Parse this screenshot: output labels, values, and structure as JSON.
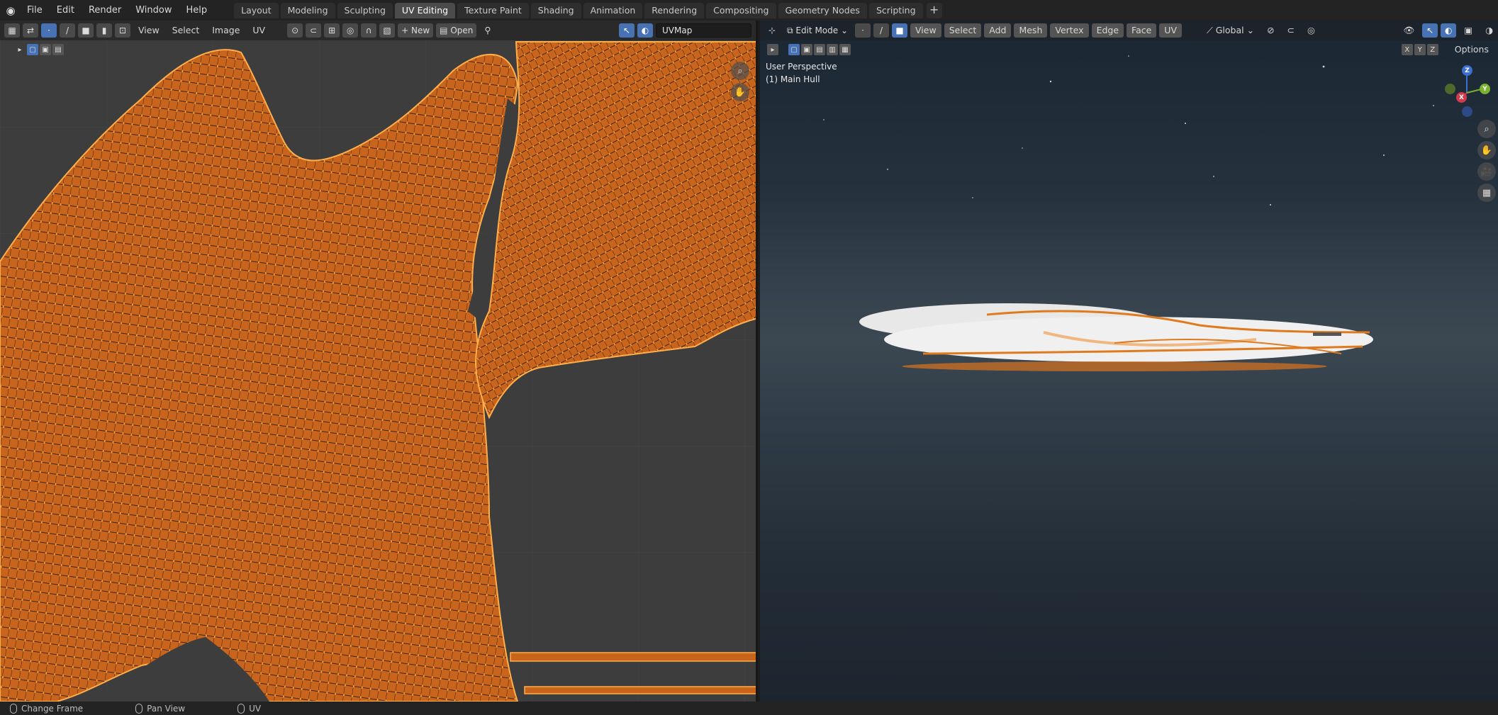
{
  "topbar": {
    "menus": [
      "File",
      "Edit",
      "Render",
      "Window",
      "Help"
    ],
    "tabs": [
      "Layout",
      "Modeling",
      "Sculpting",
      "UV Editing",
      "Texture Paint",
      "Shading",
      "Animation",
      "Rendering",
      "Compositing",
      "Geometry Nodes",
      "Scripting"
    ],
    "active_tab": "UV Editing",
    "add_tab": "+"
  },
  "uv_editor": {
    "menus": [
      "View",
      "Select",
      "Image",
      "UV"
    ],
    "new_label": "New",
    "open_label": "Open",
    "uvmap_value": "UVMap",
    "colors": {
      "mesh": "#e0701a",
      "vertex": "#ff9a2e",
      "background": "#3d3d3d"
    }
  },
  "viewport": {
    "mode_label": "Edit Mode",
    "menus": [
      "View",
      "Select",
      "Add",
      "Mesh",
      "Vertex",
      "Edge",
      "Face",
      "UV"
    ],
    "transform_orientation": "Global",
    "options_label": "Options",
    "axis_labels": [
      "X",
      "Y",
      "Z"
    ],
    "perspective_label": "User Perspective",
    "object_label": "(1) Main Hull",
    "gizmo": {
      "z": "Z",
      "x": "X",
      "y": "Y"
    }
  },
  "statusbar": {
    "items": [
      "Change Frame",
      "Pan View",
      "UV"
    ]
  }
}
